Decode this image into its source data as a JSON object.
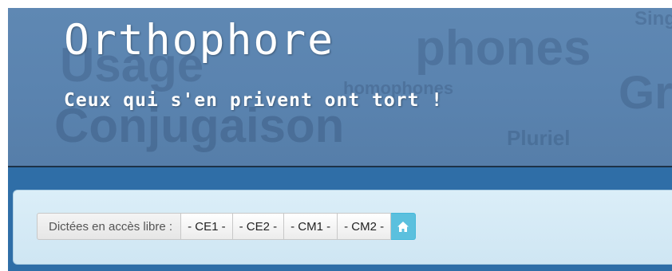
{
  "banner": {
    "title": "Orthophore",
    "subtitle": "Ceux qui s'en privent ont tort !",
    "background_words": [
      "Usage",
      "phones",
      "Conjugaison",
      "Gr",
      "Sing",
      "Pluriel",
      "homophones"
    ]
  },
  "toolbar": {
    "label": "Dictées en accès libre :",
    "buttons": [
      "- CE1 -",
      "- CE2 -",
      "- CM1 -",
      "- CM2 -"
    ],
    "home_icon": "home-icon"
  },
  "colors": {
    "banner": "#5a83af",
    "bar": "#2f6ea7",
    "panel": "#d5eaf5",
    "home_button": "#5bc0de"
  }
}
